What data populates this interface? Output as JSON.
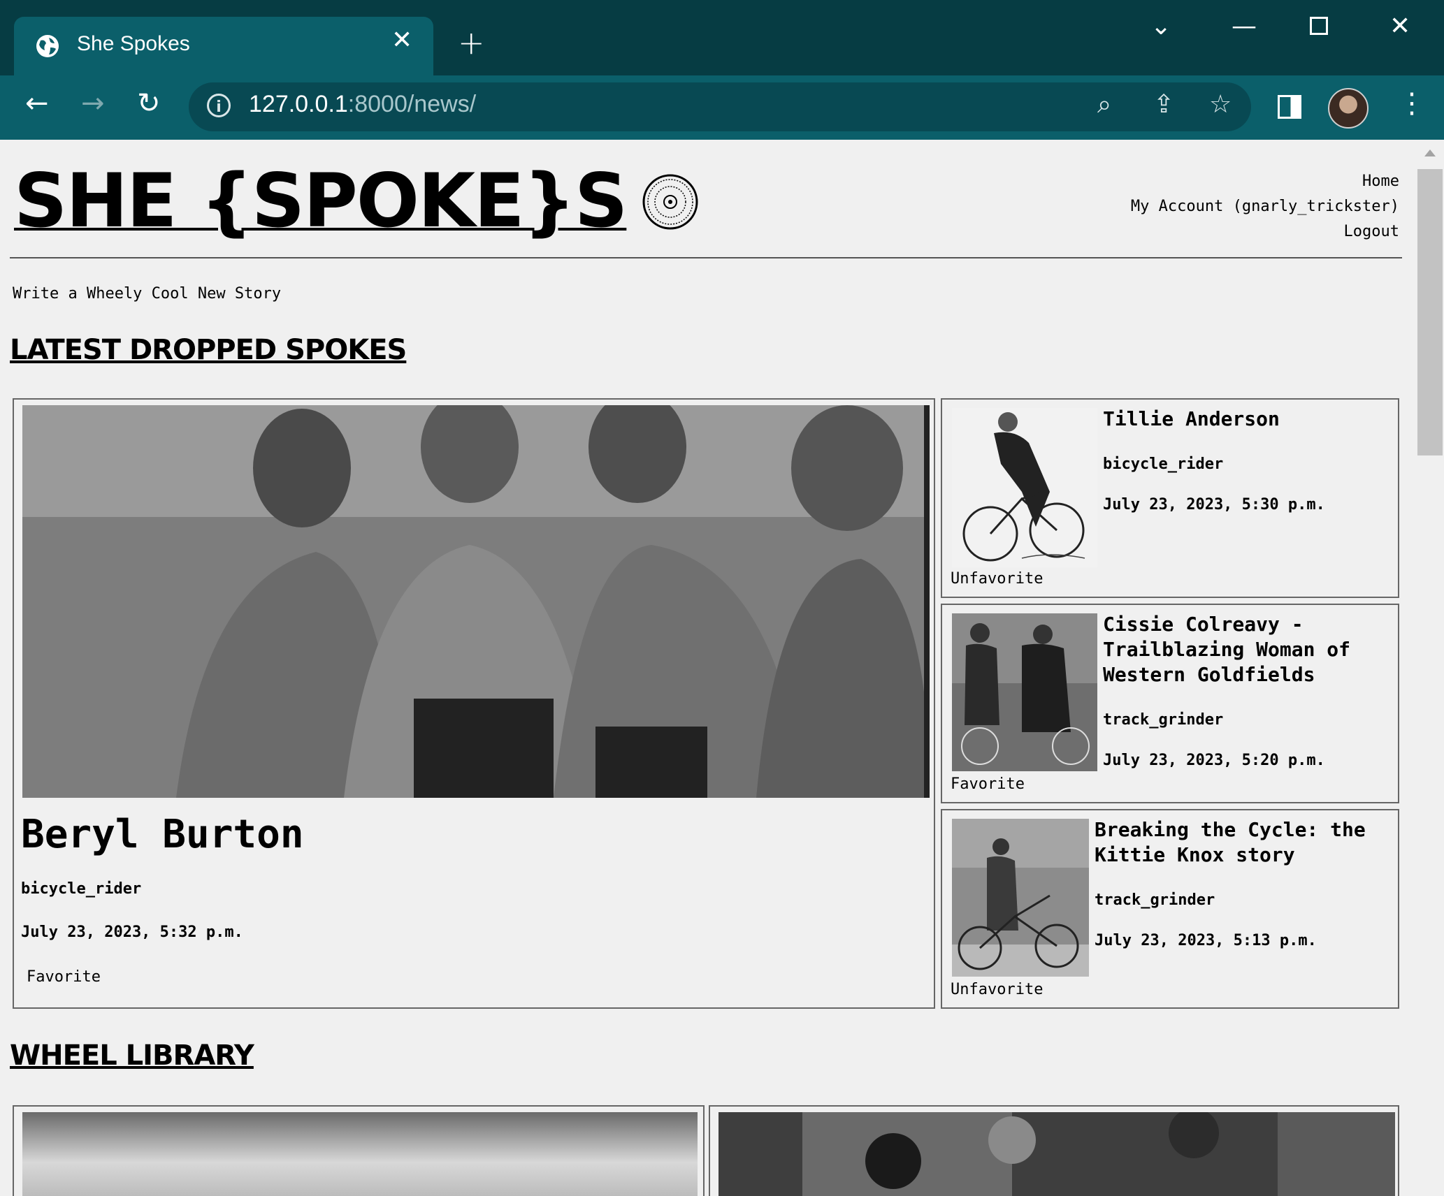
{
  "browser": {
    "tab_title": "She Spokes",
    "url_host": "127.0.0.1",
    "url_path": ":8000/news/"
  },
  "site": {
    "logo": "SHE {SPOKE}S",
    "nav": [
      "Home",
      "My Account (gnarly_trickster)",
      "Logout"
    ],
    "write_link": "Write a Wheely Cool New Story"
  },
  "latest": {
    "heading": "LATEST DROPPED SPOKES",
    "featured": {
      "title": "Beryl Burton",
      "author": "bicycle_rider",
      "date": "July 23, 2023, 5:32 p.m.",
      "favorite_label": "Favorite"
    },
    "side": [
      {
        "title": "Tillie Anderson",
        "author": "bicycle_rider",
        "date": "July 23, 2023, 5:30 p.m.",
        "favorite_label": "Unfavorite"
      },
      {
        "title": "Cissie Colreavy - Trailblazing Woman of Western Goldfields",
        "author": "track_grinder",
        "date": "July 23, 2023, 5:20 p.m.",
        "favorite_label": "Favorite"
      },
      {
        "title": "Breaking the Cycle: the Kittie Knox story",
        "author": "track_grinder",
        "date": "July 23, 2023, 5:13 p.m.",
        "favorite_label": "Unfavorite"
      }
    ]
  },
  "library": {
    "heading": "WHEEL LIBRARY"
  },
  "icons": {
    "tab": "globe-icon",
    "reload": "reload-icon",
    "site_logo": "bicycle-wheel-icon"
  }
}
